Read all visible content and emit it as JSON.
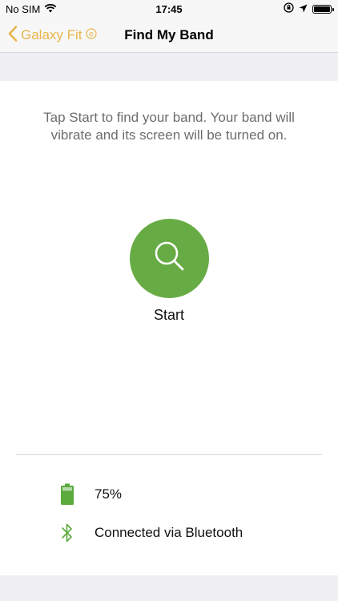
{
  "status_bar": {
    "carrier": "No SIM",
    "time": "17:45"
  },
  "nav": {
    "back_label": "Galaxy Fit",
    "back_badge": "e",
    "title": "Find My Band"
  },
  "main": {
    "instruction": "Tap Start to find your band. Your band will vibrate and its screen will be turned on.",
    "start_label": "Start"
  },
  "info": {
    "battery_text": "75%",
    "battery_level": 0.75,
    "connection_text": "Connected via Bluetooth"
  },
  "colors": {
    "accent_back": "#e8b54a",
    "start_green": "#67ab45",
    "icon_green": "#5aaa3c"
  },
  "icons": {
    "wifi": "wifi-icon",
    "orientation_lock": "orientation-lock-icon",
    "location": "location-arrow-icon",
    "battery": "battery-icon",
    "back": "chevron-left-icon",
    "search": "search-icon",
    "band_battery": "battery-icon",
    "bluetooth": "bluetooth-icon"
  }
}
